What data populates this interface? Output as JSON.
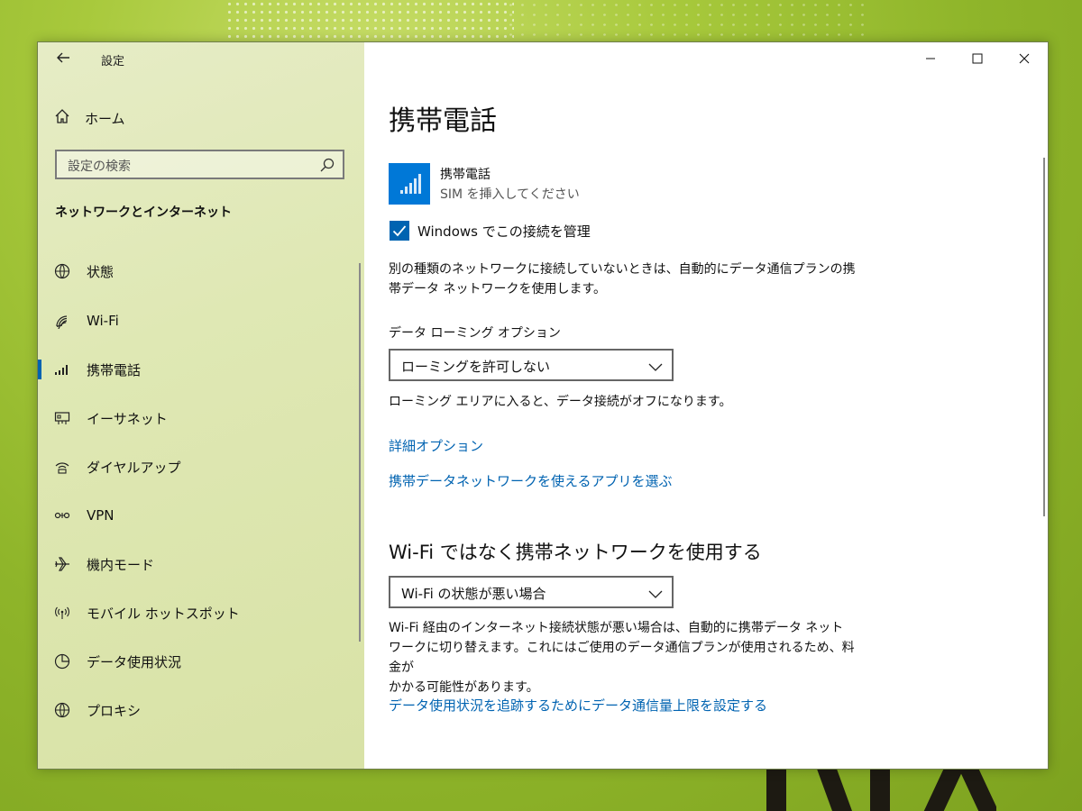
{
  "window": {
    "title": "設定"
  },
  "sidebar": {
    "home_label": "ホーム",
    "search_placeholder": "設定の検索",
    "section_title": "ネットワークとインターネット",
    "items": [
      {
        "label": "状態",
        "icon": "globe-icon"
      },
      {
        "label": "Wi-Fi",
        "icon": "wifi-icon"
      },
      {
        "label": "携帯電話",
        "icon": "cellular-icon",
        "active": true
      },
      {
        "label": "イーサネット",
        "icon": "ethernet-icon"
      },
      {
        "label": "ダイヤルアップ",
        "icon": "dialup-icon"
      },
      {
        "label": "VPN",
        "icon": "vpn-icon"
      },
      {
        "label": "機内モード",
        "icon": "airplane-icon"
      },
      {
        "label": "モバイル ホットスポット",
        "icon": "hotspot-icon"
      },
      {
        "label": "データ使用状況",
        "icon": "data-usage-icon"
      },
      {
        "label": "プロキシ",
        "icon": "proxy-globe-icon"
      }
    ]
  },
  "main": {
    "page_title": "携帯電話",
    "cellular": {
      "name": "携帯電話",
      "status": "SIM を挿入してください"
    },
    "manage_checkbox": {
      "label": "Windows でこの接続を管理",
      "checked": true
    },
    "manage_desc": [
      "別の種類のネットワークに接続していないときは、自動的にデータ通信プランの携",
      "帯データ ネットワークを使用します。"
    ],
    "roaming": {
      "label": "データ ローミング オプション",
      "selected": "ローミングを許可しない",
      "desc": "ローミング エリアに入ると、データ接続がオフになります。"
    },
    "links": {
      "advanced": "詳細オプション",
      "choose_apps": "携帯データネットワークを使えるアプリを選ぶ",
      "set_limit": "データ使用状況を追跡するためにデータ通信量上限を設定する"
    },
    "wifi_section": {
      "title": "Wi-Fi ではなく携帯ネットワークを使用する",
      "selected": "Wi-Fi の状態が悪い場合",
      "desc": [
        "Wi-Fi 経由のインターネット接続状態が悪い場合は、自動的に携帯データ ネット",
        "ワークに切り替えます。これにはご使用のデータ通信プランが使用されるため、料金が",
        "かかる可能性があります。"
      ]
    }
  },
  "colors": {
    "accent": "#0063b1",
    "tile": "#0078d7"
  }
}
